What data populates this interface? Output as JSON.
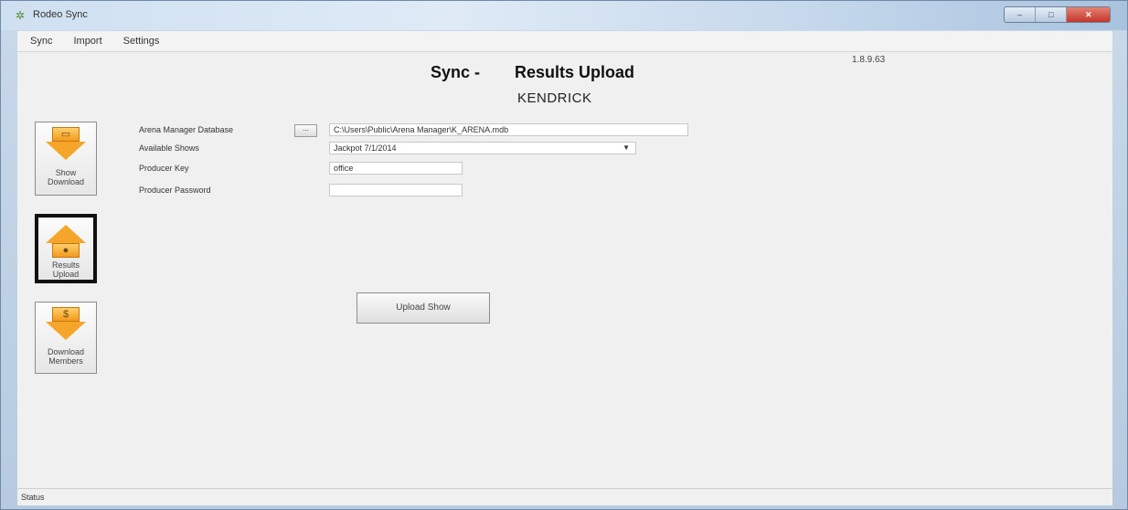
{
  "window": {
    "title": "Rodeo Sync",
    "app_icon": "rodeo-sync-icon"
  },
  "menu": [
    "Sync",
    "Import",
    "Settings"
  ],
  "version": "1.8.9.63",
  "heading": {
    "prefix": "Sync -",
    "title": "Results Upload",
    "subtitle": "KENDRICK"
  },
  "sidebar": [
    {
      "label_line1": "Show",
      "label_line2": "Download",
      "icon": "download-arrow-icon"
    },
    {
      "label_line1": "Results",
      "label_line2": "Upload",
      "icon": "upload-arrow-icon"
    },
    {
      "label_line1": "Download",
      "label_line2": "Members",
      "icon": "dollar-download-icon"
    }
  ],
  "form": {
    "database_label": "Arena Manager Database",
    "browse_label": "...",
    "database_path": "C:\\Users\\Public\\Arena Manager\\K_ARENA.mdb",
    "shows_label": "Available Shows",
    "selected_show": "Jackpot 7/1/2014",
    "key_label": "Producer Key",
    "key_value": "office",
    "password_label": "Producer Password",
    "password_value": ""
  },
  "upload_button": "Upload Show",
  "status": "Status"
}
